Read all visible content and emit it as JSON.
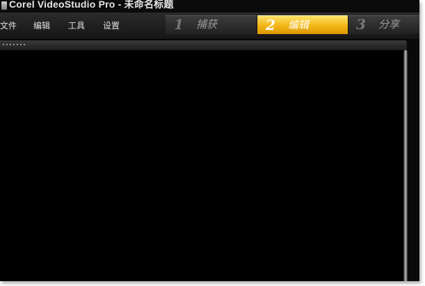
{
  "window": {
    "title": "Corel VideoStudio Pro - 未命名标题"
  },
  "menu": {
    "items": [
      "文件",
      "编辑",
      "工具",
      "设置"
    ]
  },
  "steps": [
    {
      "number": "1",
      "label": "捕获",
      "active": false
    },
    {
      "number": "2",
      "label": "编辑",
      "active": true
    },
    {
      "number": "3",
      "label": "分享",
      "active": false
    }
  ],
  "colors": {
    "active_tab": "#f3b514",
    "background": "#050505"
  },
  "icons": {
    "app": "videostudio-app-icon",
    "panel_grip": "grip-dots-icon"
  }
}
